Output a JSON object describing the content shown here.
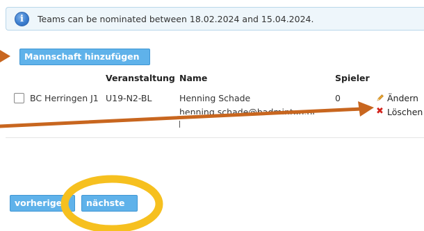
{
  "info": {
    "icon": "info-icon",
    "text": "Teams can be nominated between 18.02.2024 and 15.04.2024."
  },
  "toolbar": {
    "add_team_label": "Mannschaft hinzufügen"
  },
  "table": {
    "headers": {
      "veranstaltung": "Veranstaltung",
      "name": "Name",
      "spieler": "Spieler"
    },
    "rows": [
      {
        "team": "BC Herringen J1",
        "veranstaltung": "U19-N2-BL",
        "name": "Henning Schade",
        "email": "henning.schade@badminton.nrw",
        "spieler": "0",
        "edit_label": "Ändern",
        "delete_label": "Löschen"
      }
    ]
  },
  "pagination": {
    "prev_label": "vorherige",
    "next_label": "nächste"
  },
  "colors": {
    "button": "#5fb2ea",
    "annotation_arrow": "#c8661f",
    "annotation_circle": "#f6c01f",
    "delete": "#d2221b"
  }
}
